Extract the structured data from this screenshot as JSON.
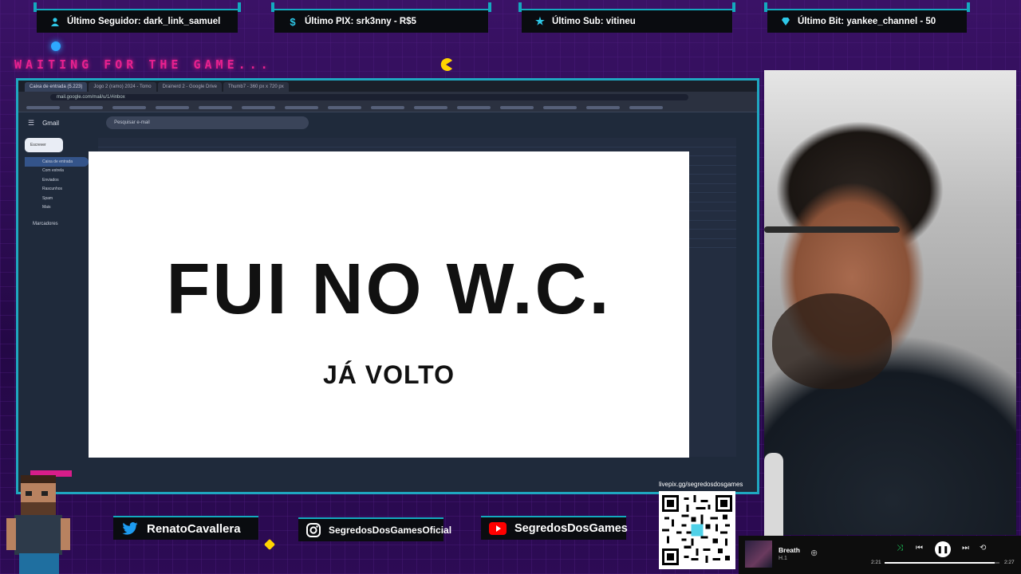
{
  "alerts": {
    "follower": "Último Seguidor: dark_link_samuel",
    "pix": "Último PIX: srk3nny - R$5",
    "sub": "Último Sub: vitineu",
    "bit": "Último Bit: yankee_channel - 50"
  },
  "waiting_text": "WAITING FOR THE GAME...",
  "browser": {
    "tabs": [
      "Caixa de entrada (5.223)",
      "Jogo 2 (ramo) 2024 - Tomo",
      "Drainerd 2 - Google Drive",
      "Thumb7 - 360 px x 720 px"
    ],
    "url": "mail.google.com/mail/u/1/#inbox"
  },
  "gmail": {
    "logo": "Gmail",
    "search_placeholder": "Pesquisar e-mail",
    "compose": "Escrever",
    "nav": [
      "Caixa de entrada",
      "Com estrela",
      "Enviados",
      "Rascunhos",
      "Spam",
      "Mais"
    ],
    "labels_header": "Marcadores"
  },
  "brb": {
    "title": "FUI NO W.C.",
    "subtitle": "JÁ VOLTO"
  },
  "socials": {
    "twitter": "RenatoCavallera",
    "instagram": "SegredosDosGamesOficial",
    "youtube": "SegredosDosGames"
  },
  "qr": {
    "label": "livepix.gg/segredosdosgames"
  },
  "player": {
    "track": "Breath",
    "artist": "H.1",
    "elapsed": "2:21",
    "duration": "2:27",
    "progress_fraction": 0.96
  },
  "colors": {
    "accent": "#14a9bf",
    "neon_pink": "#e8218f",
    "background": "#2a0b4a"
  }
}
